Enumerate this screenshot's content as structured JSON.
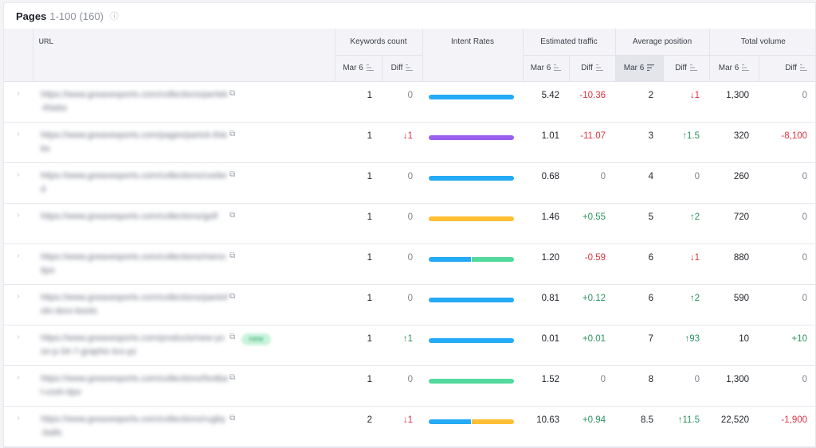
{
  "title": {
    "main": "Pages",
    "range": "1-100",
    "count": "(160)",
    "info_icon": "info-icon"
  },
  "colors": {
    "informational": "#25aaf5",
    "navigational": "#9b5ff0",
    "commercial": "#ffbe33",
    "transactional": "#52d99c",
    "negative": "#e0313f",
    "positive": "#2a9460"
  },
  "header": {
    "url": "URL",
    "groups": {
      "keywords_count": "Keywords count",
      "intent_rates": "Intent Rates",
      "estimated_traffic": "Estimated traffic",
      "average_position": "Average position",
      "total_volume": "Total volume"
    },
    "sub": {
      "date": "Mar 6",
      "diff": "Diff"
    }
  },
  "rows": [
    {
      "url": "https://www.greavesports.com/collections/pertek-thiebs",
      "badge": "",
      "kw": "1",
      "kw_diff": "0",
      "intent": [
        [
          "informational",
          1
        ]
      ],
      "et": "5.42",
      "et_diff": "-10.36",
      "ap": "2",
      "ap_diff": "↓1",
      "tv": "1,300",
      "tv_diff": "0"
    },
    {
      "url": "https://www.greavesports.com/pages/partck-thiebs",
      "badge": "",
      "kw": "1",
      "kw_diff": "↓1",
      "intent": [
        [
          "navigational",
          1
        ]
      ],
      "et": "1.01",
      "et_diff": "-11.07",
      "ap": "3",
      "ap_diff": "↑1.5",
      "tv": "320",
      "tv_diff": "-8,100"
    },
    {
      "url": "https://www.greavesports.com/collections/coolerd",
      "badge": "",
      "kw": "1",
      "kw_diff": "0",
      "intent": [
        [
          "informational",
          1
        ]
      ],
      "et": "0.68",
      "et_diff": "0",
      "ap": "4",
      "ap_diff": "0",
      "tv": "260",
      "tv_diff": "0"
    },
    {
      "url": "https://www.greavesports.com/collections/golf",
      "badge": "",
      "kw": "1",
      "kw_diff": "0",
      "intent": [
        [
          "commercial",
          1
        ]
      ],
      "et": "1.46",
      "et_diff": "+0.55",
      "ap": "5",
      "ap_diff": "↑2",
      "tv": "720",
      "tv_diff": "0"
    },
    {
      "url": "https://www.greavesports.com/collections/mens-tipo",
      "badge": "",
      "kw": "1",
      "kw_diff": "0",
      "intent": [
        [
          "informational",
          0.5
        ],
        [
          "transactional",
          0.5
        ]
      ],
      "et": "1.20",
      "et_diff": "-0.59",
      "ap": "6",
      "ap_diff": "↓1",
      "tv": "880",
      "tv_diff": "0"
    },
    {
      "url": "https://www.greavesports.com/collections/pantofolo-doro-boots",
      "badge": "",
      "kw": "1",
      "kw_diff": "0",
      "intent": [
        [
          "informational",
          1
        ]
      ],
      "et": "0.81",
      "et_diff": "+0.12",
      "ap": "6",
      "ap_diff": "↑2",
      "tv": "590",
      "tv_diff": "0"
    },
    {
      "url": "https://www.greavesports.com/products/new-yoso-p-34-7-graphic-tco-pz",
      "badge": "new",
      "kw": "1",
      "kw_diff": "↑1",
      "intent": [
        [
          "informational",
          1
        ]
      ],
      "et": "0.01",
      "et_diff": "+0.01",
      "ap": "7",
      "ap_diff": "↑93",
      "tv": "10",
      "tv_diff": "+10"
    },
    {
      "url": "https://www.greavesports.com/collections/footbal-cosh-tipo",
      "badge": "",
      "kw": "1",
      "kw_diff": "0",
      "intent": [
        [
          "transactional",
          1
        ]
      ],
      "et": "1.52",
      "et_diff": "0",
      "ap": "8",
      "ap_diff": "0",
      "tv": "1,300",
      "tv_diff": "0"
    },
    {
      "url": "https://www.greavesports.com/collections/rugby-balls",
      "badge": "",
      "kw": "2",
      "kw_diff": "↓1",
      "intent": [
        [
          "informational",
          0.5
        ],
        [
          "commercial",
          0.5
        ]
      ],
      "et": "10.63",
      "et_diff": "+0.94",
      "ap": "8.5",
      "ap_diff": "↑11.5",
      "tv": "22,520",
      "tv_diff": "-1,900"
    }
  ]
}
